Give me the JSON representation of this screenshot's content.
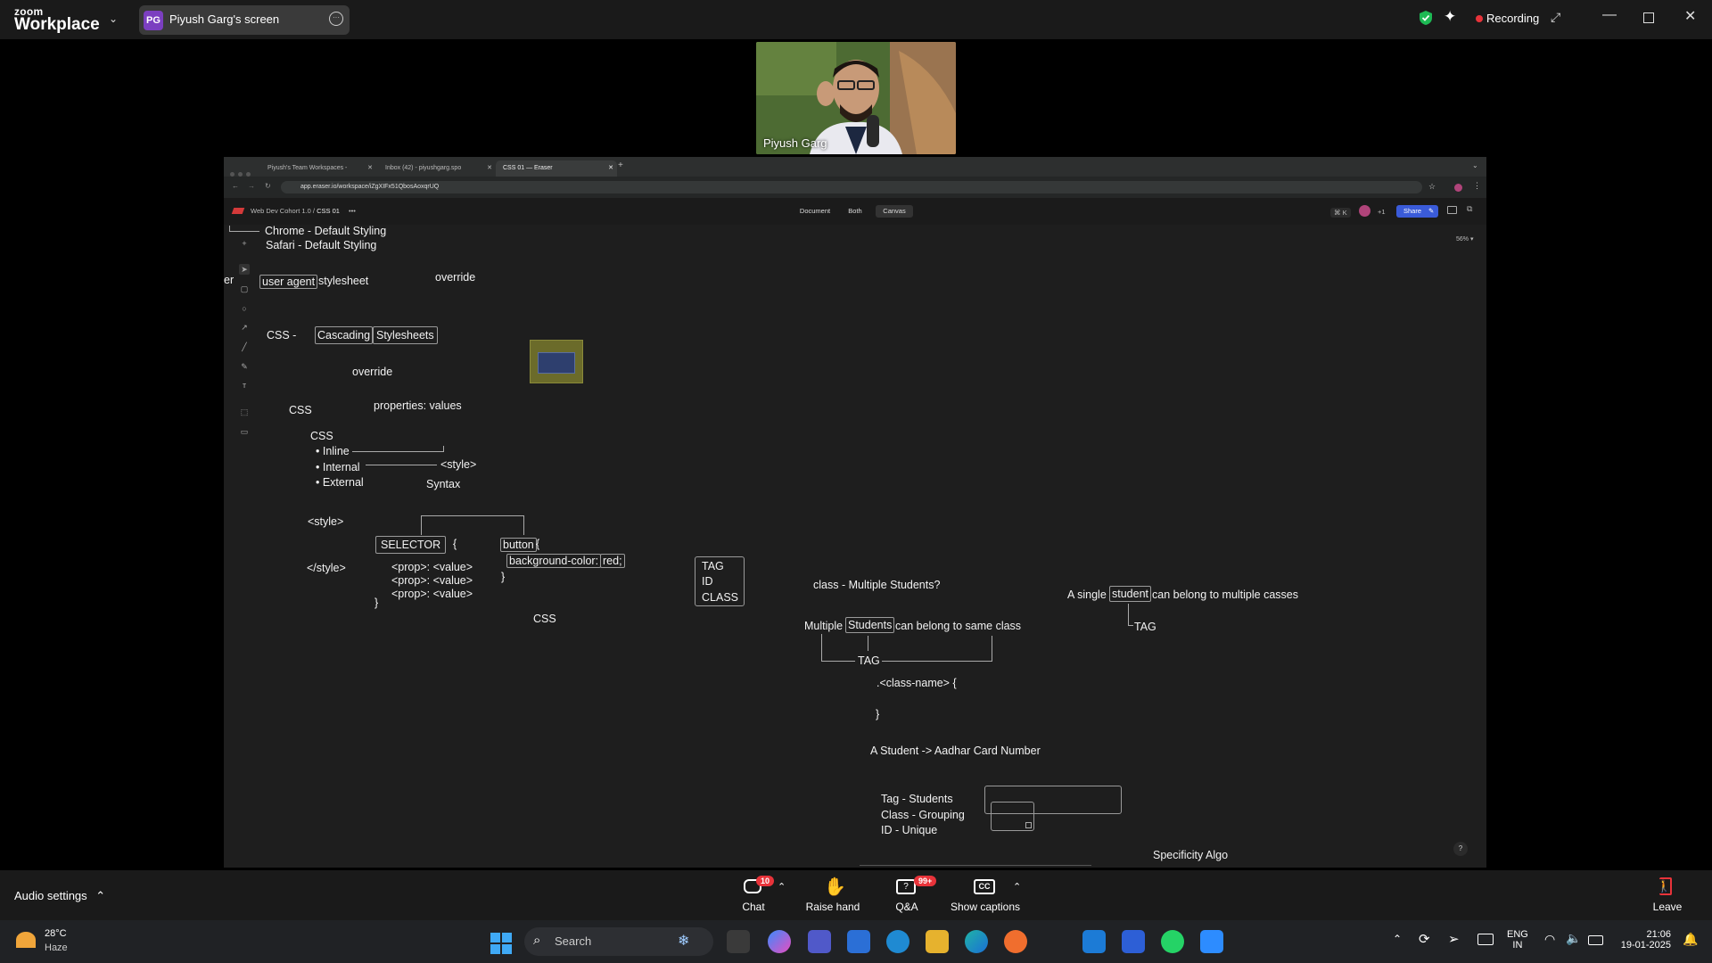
{
  "zoom": {
    "brand_top": "zoom",
    "brand_bottom": "Workplace",
    "share_initials": "PG",
    "share_label": "Piyush Garg's screen",
    "recording_label": "Recording",
    "participant_name": "Piyush Garg",
    "audio_settings": "Audio settings",
    "chat_label": "Chat",
    "chat_count": "10",
    "raise_hand_label": "Raise hand",
    "qa_label": "Q&A",
    "qa_count": "99+",
    "captions_label": "Show captions",
    "leave_label": "Leave"
  },
  "browser": {
    "tabs": [
      {
        "label": "Piyush's Team Workspaces -"
      },
      {
        "label": "Inbox (42) - piyushgarg.spo"
      },
      {
        "label": "CSS 01 — Eraser"
      }
    ],
    "url": "app.eraser.io/workspace/iZgXIFx51QbosAoxqrUQ"
  },
  "eraser": {
    "breadcrumb_root": "Web Dev Cohort 1.0",
    "breadcrumb_sep": "/",
    "doc_title": "CSS 01",
    "more": "•••",
    "modes": [
      "Document",
      "Both",
      "Canvas"
    ],
    "shortcut": "⌘ K",
    "collab_count": "+1",
    "share_label": "Share",
    "zoom_level": "56% ▾",
    "help": "?"
  },
  "canvas": {
    "chrome_default": "Chrome - Default Styling",
    "safari_default": "Safari - Default Styling",
    "edge_fragment": "er",
    "user_agent": "user agent",
    "stylesheet": "stylesheet",
    "override_1": "override",
    "css_dash": "CSS -",
    "cascading": "Cascading",
    "stylesheets": "Stylesheets",
    "override_2": "override",
    "css_1": "CSS",
    "properties_values": "properties: values",
    "css_2": "CSS",
    "inline": "• Inline",
    "internal": "• Internal",
    "external": "• External",
    "style_tag_arrow": "<style>",
    "syntax": "Syntax",
    "style_open": "<style>",
    "style_close": "</style>",
    "selector": "SELECTOR",
    "brace_open": "{",
    "prop1": "<prop>: <value>",
    "prop2": "<prop>: <value>",
    "prop3": "<prop>: <value>",
    "brace_close": "}",
    "button": "button",
    "button_brace": "{",
    "background_color": "background-color:",
    "red": "red;",
    "button_close": "}",
    "css_3": "CSS",
    "tag": "TAG",
    "id": "ID",
    "class": "CLASS",
    "class_multiple": "class - Multiple Students?",
    "multiple": "Multiple",
    "students": "Students",
    "same_class": "can belong to same class",
    "tag_2": "TAG",
    "class_name": ".<class-name> {",
    "class_close": "}",
    "aadhar": "A Student -> Aadhar Card Number",
    "tag_students": "Tag - Students",
    "class_grouping": "Class - Grouping",
    "id_unique": "ID - Unique",
    "single": "A single",
    "student": "student",
    "multiple_casses": "can belong to multiple casses",
    "tag_3": "TAG",
    "specificity": "Specificity Algo"
  },
  "taskbar": {
    "temp": "28°C",
    "weather": "Haze",
    "search_placeholder": "Search",
    "lang_top": "ENG",
    "lang_bottom": "IN",
    "time": "21:06",
    "date": "19-01-2025"
  },
  "colors": {
    "zoom_bg": "#1a1a1a",
    "recording_red": "#e8333a",
    "share_blue": "#3a5bd9",
    "canvas_bg": "#1e1e1e",
    "sticky_olive": "#6b6b2a",
    "sticky_blue": "#2e3f6e"
  }
}
